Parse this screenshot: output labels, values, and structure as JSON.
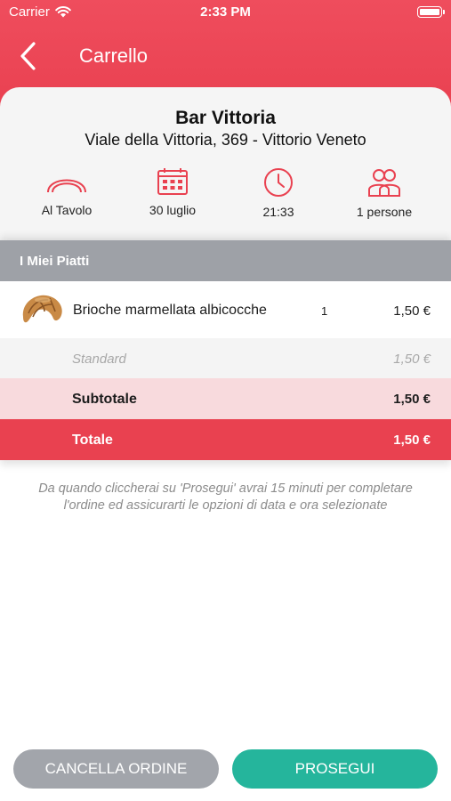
{
  "status_bar": {
    "carrier": "Carrier",
    "time": "2:33 PM"
  },
  "nav": {
    "title": "Carrello"
  },
  "venue": {
    "name": "Bar Vittoria",
    "address": "Viale della Vittoria, 369 - Vittorio Veneto"
  },
  "info": [
    {
      "icon": "table-icon",
      "label": "Al Tavolo"
    },
    {
      "icon": "calendar-icon",
      "label": "30 luglio"
    },
    {
      "icon": "clock-icon",
      "label": "21:33"
    },
    {
      "icon": "people-icon",
      "label": "1 persone"
    }
  ],
  "section": {
    "title": "I Miei Piatti"
  },
  "items": [
    {
      "name": "Brioche marmellata albicocche",
      "qty": "1",
      "price": "1,50 €"
    }
  ],
  "standard": {
    "label": "Standard",
    "price": "1,50 €"
  },
  "subtotal": {
    "label": "Subtotale",
    "value": "1,50 €"
  },
  "total": {
    "label": "Totale",
    "value": "1,50 €"
  },
  "notice": "Da quando cliccherai su 'Prosegui' avrai 15 minuti per completare l'ordine ed assicurarti le opzioni di data e ora selezionate",
  "buttons": {
    "cancel": "CANCELLA ORDINE",
    "continue": "PROSEGUI"
  },
  "colors": {
    "accent": "#e94150",
    "continue": "#25b59c",
    "cancel": "#a2a5ab",
    "section": "#9ea1a7"
  }
}
